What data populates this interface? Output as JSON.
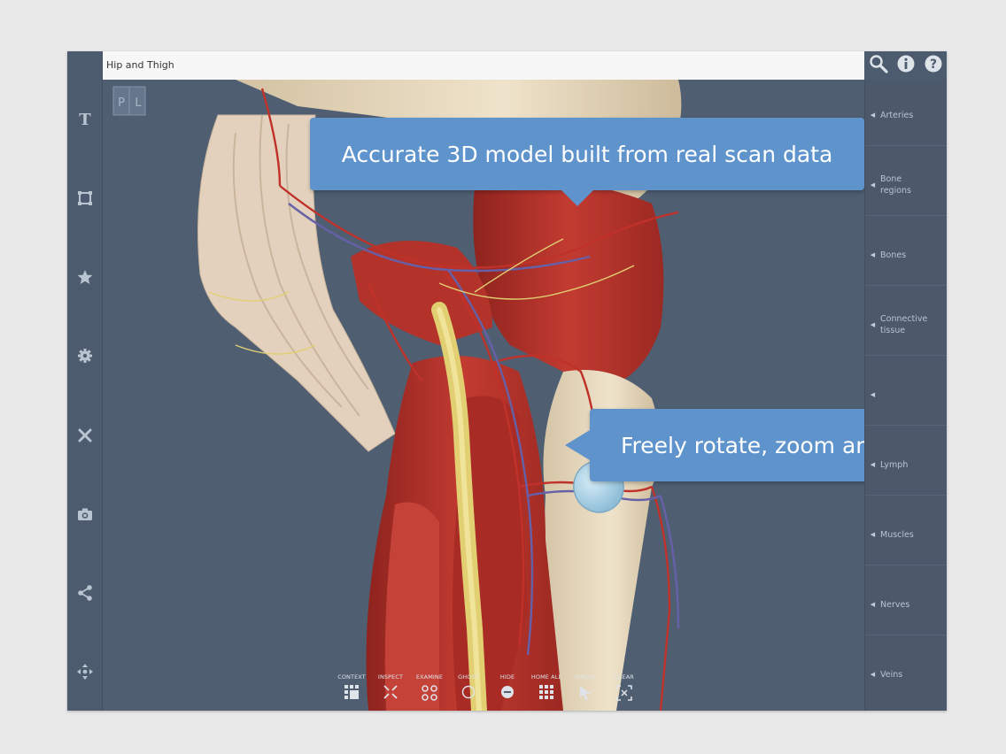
{
  "window": {
    "title": "Hip and Thigh"
  },
  "cube": {
    "labels": [
      "P",
      "L"
    ]
  },
  "toolbar_left": [
    "text-tool",
    "frame-tool",
    "favorites",
    "settings",
    "pin-tool",
    "camera",
    "share",
    "move"
  ],
  "top_icons": [
    "search-icon",
    "info-icon",
    "help-icon"
  ],
  "categories": [
    {
      "label": "Arteries"
    },
    {
      "label": "Bone regions"
    },
    {
      "label": "Bones"
    },
    {
      "label": "Connective tissue"
    },
    {
      "label": ""
    },
    {
      "label": "Lymph"
    },
    {
      "label": "Muscles"
    },
    {
      "label": "Nerves"
    },
    {
      "label": "Veins"
    }
  ],
  "callouts": {
    "top": "Accurate 3D model built from real scan data",
    "right": "Freely rotate, zoom and pan"
  },
  "bottom_toolbar": [
    {
      "label": "CONTEXT"
    },
    {
      "label": "INSPECT"
    },
    {
      "label": "EXAMINE"
    },
    {
      "label": "GHOST"
    },
    {
      "label": "HIDE"
    },
    {
      "label": "HOME ALL"
    },
    {
      "label": "SINGLE"
    },
    {
      "label": "CLEAR"
    }
  ],
  "colors": {
    "background": "#4f5e71",
    "callout": "#5f93cb",
    "muscle": "#b8332b",
    "bone": "#e4d5b8",
    "artery": "#c0312a",
    "vein": "#6660a8",
    "nerve": "#e1cf72",
    "lymph_node": "#a6cfe5"
  }
}
